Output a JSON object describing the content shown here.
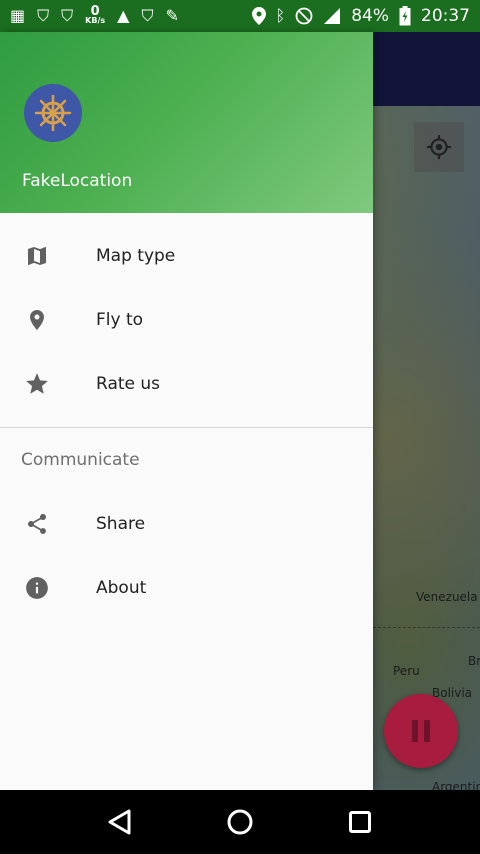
{
  "status_bar": {
    "speed_value": "0",
    "speed_unit": "KB/s",
    "battery": "84%",
    "time": "20:37"
  },
  "drawer": {
    "app_name": "FakeLocation",
    "items": [
      {
        "label": "Map type",
        "icon": "map-icon"
      },
      {
        "label": "Fly to",
        "icon": "location-pin-icon"
      },
      {
        "label": "Rate us",
        "icon": "star-icon"
      }
    ],
    "section_title": "Communicate",
    "section_items": [
      {
        "label": "Share",
        "icon": "share-icon"
      },
      {
        "label": "About",
        "icon": "info-icon"
      }
    ]
  },
  "map": {
    "labels": [
      "Venezuela",
      "Peru",
      "Br",
      "Bolivia",
      "Argentin"
    ]
  },
  "colors": {
    "header_green": "#4caf50",
    "status_bar": "#1b6e20",
    "fab": "#a81c3f"
  }
}
